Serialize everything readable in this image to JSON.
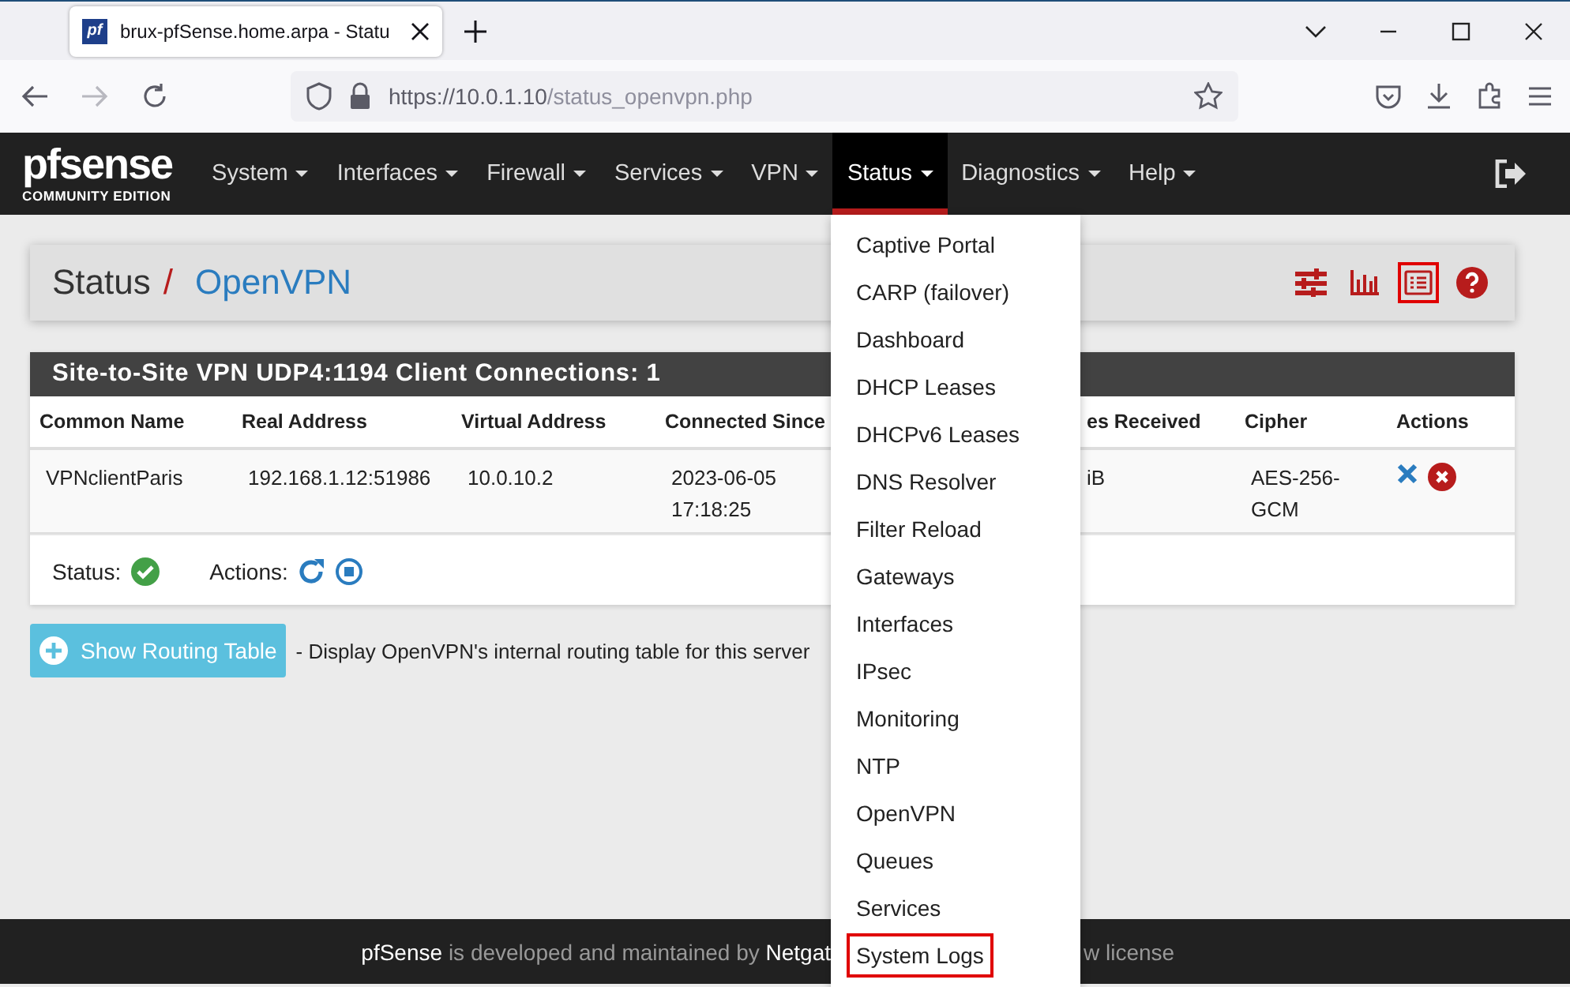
{
  "browser": {
    "tab": {
      "favicon": "pf",
      "title": "brux-pfSense.home.arpa - Statu",
      "selected": true
    },
    "url_host": "https://10.0.1.10",
    "url_path": "/status_openvpn.php"
  },
  "navbar": {
    "logo": "pfsense",
    "edition": "COMMUNITY EDITION",
    "menus": [
      {
        "label": "System",
        "selected": false
      },
      {
        "label": "Interfaces",
        "selected": false
      },
      {
        "label": "Firewall",
        "selected": false
      },
      {
        "label": "Services",
        "selected": false
      },
      {
        "label": "VPN",
        "selected": false
      },
      {
        "label": "Status",
        "selected": true
      },
      {
        "label": "Diagnostics",
        "selected": false
      },
      {
        "label": "Help",
        "selected": false
      }
    ]
  },
  "breadcrumb": {
    "section": "Status",
    "separator": "/",
    "page": "OpenVPN"
  },
  "header_actions": [
    {
      "kind": "settings",
      "selected": false
    },
    {
      "kind": "chart",
      "selected": false
    },
    {
      "kind": "logs",
      "selected": true
    },
    {
      "kind": "help",
      "selected": false
    }
  ],
  "panel": {
    "title": "Site-to-Site VPN UDP4:1194 Client Connections: 1",
    "columns": [
      "Common Name",
      "Real Address",
      "Virtual Address",
      "Connected Since",
      "",
      "es Received",
      "Cipher",
      "Actions"
    ],
    "rows": [
      [
        "VPNclientParis",
        "192.168.1.12:51986",
        "10.0.10.2",
        "2023-06-05 17:18:25",
        "",
        "iB",
        "AES-256-GCM"
      ]
    ],
    "status_label": "Status:",
    "actions_label": "Actions:"
  },
  "routing": {
    "button": "Show Routing Table",
    "description": "- Display OpenVPN's internal routing table for this server"
  },
  "dropdown": {
    "items": [
      {
        "label": "Captive Portal",
        "selected": false
      },
      {
        "label": "CARP (failover)",
        "selected": false
      },
      {
        "label": "Dashboard",
        "selected": false
      },
      {
        "label": "DHCP Leases",
        "selected": false
      },
      {
        "label": "DHCPv6 Leases",
        "selected": false
      },
      {
        "label": "DNS Resolver",
        "selected": false
      },
      {
        "label": "Filter Reload",
        "selected": false
      },
      {
        "label": "Gateways",
        "selected": false
      },
      {
        "label": "Interfaces",
        "selected": false
      },
      {
        "label": "IPsec",
        "selected": false
      },
      {
        "label": "Monitoring",
        "selected": false
      },
      {
        "label": "NTP",
        "selected": false
      },
      {
        "label": "OpenVPN",
        "selected": false
      },
      {
        "label": "Queues",
        "selected": false
      },
      {
        "label": "Services",
        "selected": false
      },
      {
        "label": "System Logs",
        "selected": true
      }
    ]
  },
  "footer": {
    "brand": "pfSense",
    "text": "is developed and maintained by",
    "company": "Netgat",
    "tail": "w license"
  }
}
